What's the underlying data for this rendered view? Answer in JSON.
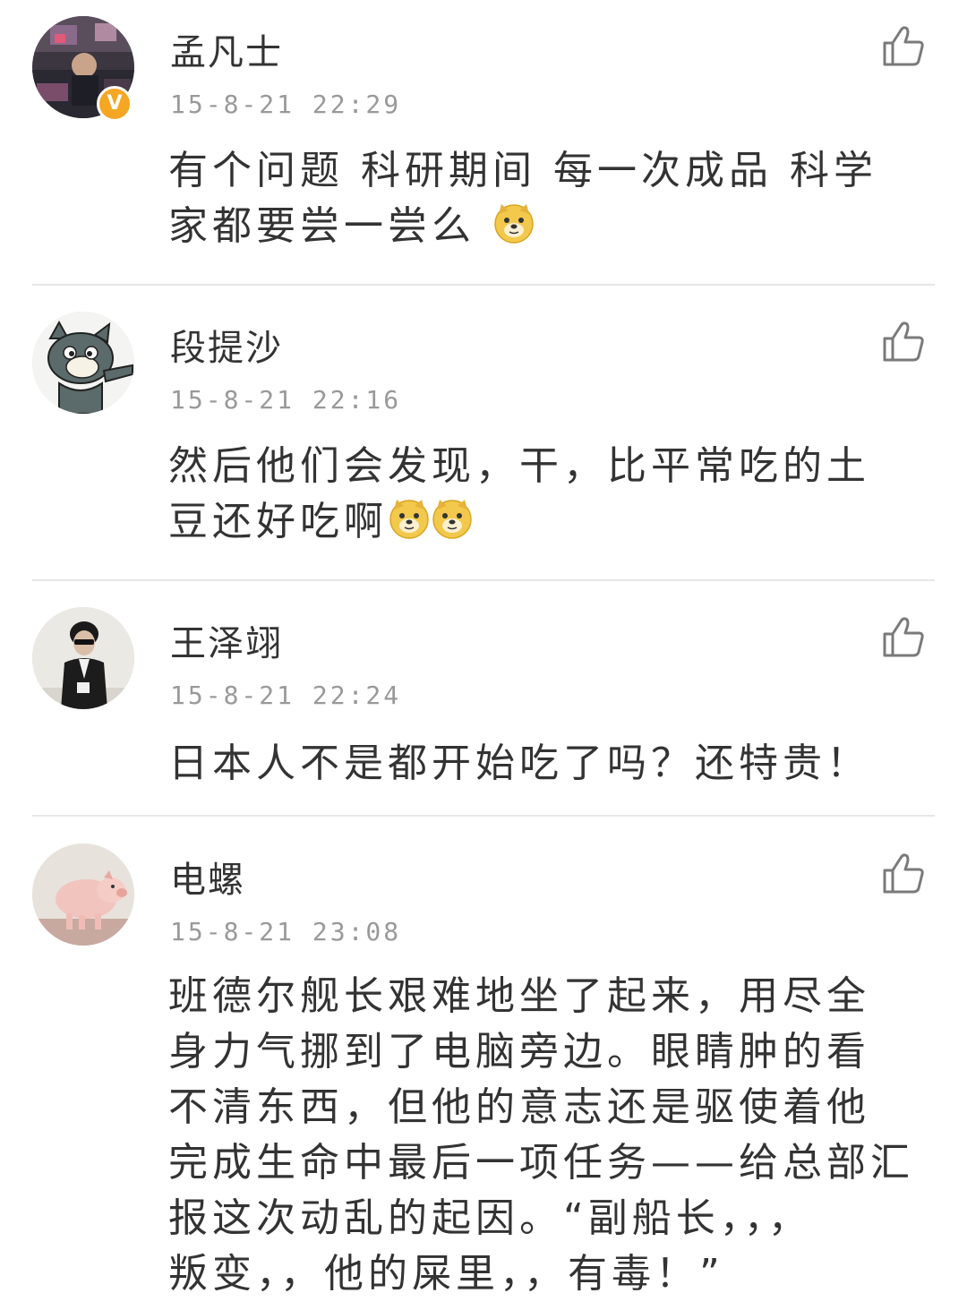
{
  "comments": [
    {
      "username": "孟凡士",
      "timestamp": "15-8-21 22:29",
      "verified": true,
      "avatar_icon": "avatar-dark-room",
      "content_lines": [
        "有个问题 科研期间 每一次成品 科学",
        "家都要尝一尝么 "
      ],
      "emoji": "doge-emoji"
    },
    {
      "username": "段提沙",
      "timestamp": "15-8-21 22:16",
      "verified": false,
      "avatar_icon": "avatar-cartoon-cat",
      "content_lines": [
        "然后他们会发现，干，比平常吃的土",
        "豆还好吃啊"
      ],
      "emoji": "doge-emoji"
    },
    {
      "username": "王泽翊",
      "timestamp": "15-8-21 22:24",
      "verified": false,
      "avatar_icon": "avatar-person-sunglasses",
      "content_lines": [
        "日本人不是都开始吃了吗？还特贵！"
      ]
    },
    {
      "username": "电螺",
      "timestamp": "15-8-21 23:08",
      "verified": false,
      "avatar_icon": "avatar-piglet",
      "content_lines": [
        "班德尔舰长艰难地坐了起来，用尽全",
        "身力气挪到了电脑旁边。眼睛肿的看",
        "不清东西，但他的意志还是驱使着他",
        "完成生命中最后一项任务——给总部汇",
        "报这次动乱的起因。“副船长，，，",
        "叛变，，他的屎里，，有毒！”"
      ]
    }
  ],
  "verified_badge": "V",
  "like_icon": "thumbs-up-icon",
  "colors": {
    "text": "#333333",
    "timestamp": "#999999",
    "divider": "#e6e6e6",
    "badge": "#f5a623"
  }
}
